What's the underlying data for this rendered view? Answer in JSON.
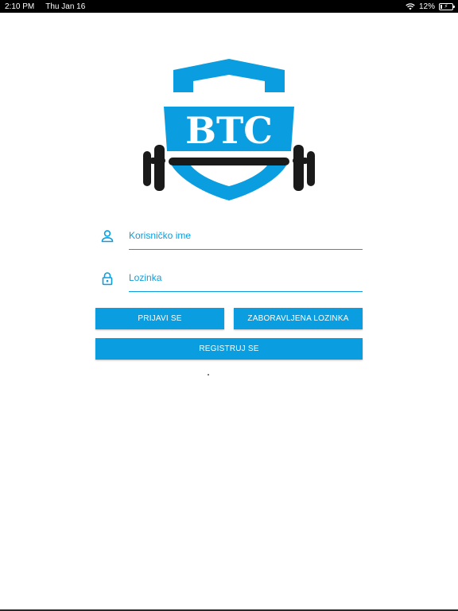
{
  "status_bar": {
    "time": "2:10 PM",
    "date": "Thu Jan 16",
    "battery_percent": "12%",
    "battery_level": 0.12,
    "icons": [
      "wifi-icon",
      "battery-icon"
    ]
  },
  "logo": {
    "text": "BTC",
    "colors": {
      "shield": "#0a9ee0",
      "barbell": "#1a1a1a",
      "text": "#ffffff"
    }
  },
  "form": {
    "username": {
      "placeholder": "Korisničko ime",
      "value": "",
      "icon": "user-icon"
    },
    "password": {
      "placeholder": "Lozinka",
      "value": "",
      "icon": "lock-icon"
    }
  },
  "buttons": {
    "login": "PRIJAVI SE",
    "forgot_password": "ZABORAVLJENA LOZINKA",
    "register": "REGISTRUJ SE"
  },
  "colors": {
    "accent": "#0a9ee0",
    "background": "#ffffff"
  }
}
